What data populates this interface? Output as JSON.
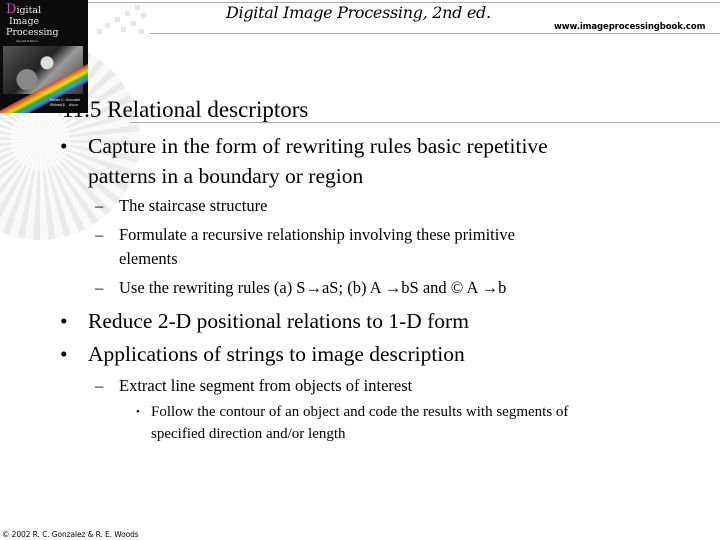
{
  "header": {
    "title": "Digital Image Processing, 2nd ed.",
    "url": "www.imageprocessingbook.com"
  },
  "cover": {
    "title_first_letter": "D",
    "title_line1": "igital",
    "title_line2_letter": "I",
    "title_line2": "mage",
    "title_line3": "Processing",
    "subtitle": "Second Edition",
    "authors_line1": "Rafael C. Gonzalez",
    "authors_line2": "Richard E. Woods"
  },
  "slide": {
    "title": "11.5 Relational descriptors",
    "bullets": [
      {
        "marker": "•",
        "lines": [
          "Capture in the form of rewriting rules basic repetitive",
          "patterns in a boundary or region"
        ],
        "sub": [
          {
            "marker": "–",
            "lines": [
              "The staircase structure"
            ]
          },
          {
            "marker": "–",
            "lines": [
              "Formulate a recursive relationship involving these primitive",
              "elements"
            ]
          },
          {
            "marker": "–",
            "lines": [
              "Use the rewriting rules (a) S→aS; (b) A →bS and © A →b"
            ]
          }
        ]
      },
      {
        "marker": "•",
        "lines": [
          "Reduce 2-D positional relations to 1-D form"
        ]
      },
      {
        "marker": "•",
        "lines": [
          "Applications of strings to image description"
        ],
        "sub": [
          {
            "marker": "–",
            "lines": [
              "Extract line segment from objects of interest"
            ],
            "sub": [
              {
                "marker": "•",
                "lines": [
                  "Follow the contour of an object  and code the results with segments of",
                  "specified direction and/or length"
                ]
              }
            ]
          }
        ]
      }
    ]
  },
  "footer": {
    "copyright": "© 2002 R. C. Gonzalez & R. E. Woods"
  },
  "colors": {
    "rule": "#a9a9a9",
    "cover_accent": "#d14fb3"
  }
}
